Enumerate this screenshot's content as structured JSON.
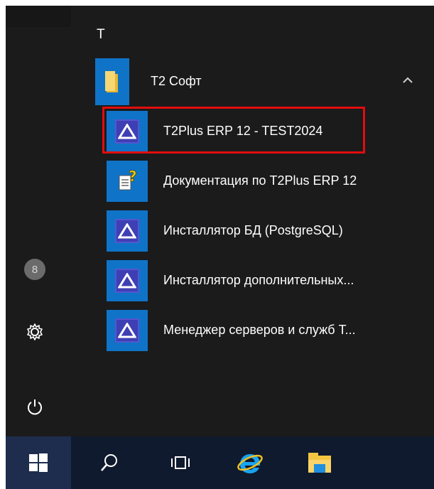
{
  "start_menu": {
    "group_letter": "T",
    "folder": {
      "label": "T2 Софт",
      "icon": "folder-icon",
      "expanded": true
    },
    "apps": [
      {
        "label": "T2Plus ERP 12 - TEST2024",
        "icon": "t2plus-delta-icon",
        "highlighted": true
      },
      {
        "label": "Документация по T2Plus ERP 12",
        "icon": "help-document-icon"
      },
      {
        "label": "Инсталлятор БД (PostgreSQL)",
        "icon": "t2plus-delta-icon"
      },
      {
        "label": "Инсталлятор дополнительных...",
        "icon": "t2plus-delta-icon"
      },
      {
        "label": "Менеджер серверов и служб Т...",
        "icon": "t2plus-delta-icon"
      }
    ],
    "left_rail": {
      "avatar_glyph": "8",
      "icons": [
        "user-avatar-icon",
        "gear-icon",
        "power-icon"
      ]
    }
  },
  "taskbar": {
    "items": [
      "windows-start-icon",
      "search-icon",
      "task-view-icon",
      "internet-explorer-icon",
      "file-explorer-icon"
    ]
  },
  "colors": {
    "tile_blue": "#0f74c8",
    "menu_bg": "#1b1b1b",
    "highlight_red": "#e20d0d",
    "taskbar_bg": "#101a2e"
  }
}
